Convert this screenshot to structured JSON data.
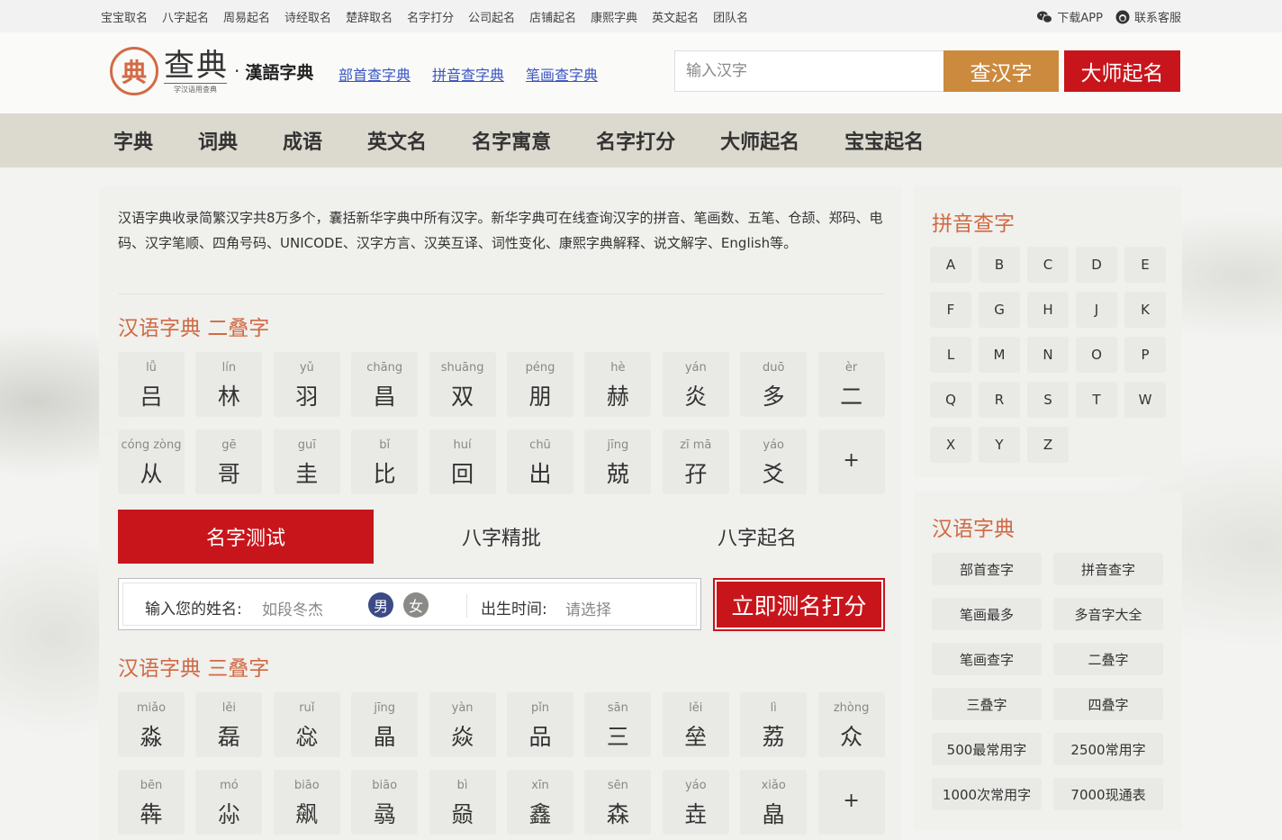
{
  "topbar": {
    "links": [
      "宝宝取名",
      "八字起名",
      "周易起名",
      "诗经取名",
      "楚辞取名",
      "名字打分",
      "公司起名",
      "店铺起名",
      "康熙字典",
      "英文起名",
      "团队名"
    ],
    "download": "下载APP",
    "service": "联系客服"
  },
  "header": {
    "logo_mark": "典",
    "logo_main": "查典",
    "logo_sub": "学汉语用查典",
    "logo_dot": "·",
    "logo_hanyu": "漢語字典",
    "links": [
      "部首查字典",
      "拼音查字典",
      "笔画查字典"
    ],
    "search_placeholder": "输入汉字",
    "search_button": "查汉字",
    "master_button": "大师起名"
  },
  "nav": [
    "字典",
    "词典",
    "成语",
    "英文名",
    "名字寓意",
    "名字打分",
    "大师起名",
    "宝宝起名"
  ],
  "main": {
    "intro": "汉语字典收录简繁汉字共8万多个，囊括新华字典中所有汉字。新华字典可在线查询汉字的拼音、笔画数、五笔、仓颉、郑码、电码、汉字笔顺、四角号码、UNICODE、汉字方言、汉英互译、词性变化、康熙字典解释、说文解字、English等。",
    "section_double": "汉语字典 二叠字",
    "double_chars": [
      {
        "py": "lǚ",
        "hz": "吕"
      },
      {
        "py": "lín",
        "hz": "林"
      },
      {
        "py": "yǔ",
        "hz": "羽"
      },
      {
        "py": "chāng",
        "hz": "昌"
      },
      {
        "py": "shuāng",
        "hz": "双"
      },
      {
        "py": "péng",
        "hz": "朋"
      },
      {
        "py": "hè",
        "hz": "赫"
      },
      {
        "py": "yán",
        "hz": "炎"
      },
      {
        "py": "duō",
        "hz": "多"
      },
      {
        "py": "èr",
        "hz": "二"
      },
      {
        "py": "cóng zòng",
        "hz": "从"
      },
      {
        "py": "gē",
        "hz": "哥"
      },
      {
        "py": "guī",
        "hz": "圭"
      },
      {
        "py": "bǐ",
        "hz": "比"
      },
      {
        "py": "huí",
        "hz": "回"
      },
      {
        "py": "chū",
        "hz": "出"
      },
      {
        "py": "jīng",
        "hz": "兢"
      },
      {
        "py": "zī mā",
        "hz": "孖"
      },
      {
        "py": "yáo",
        "hz": "爻"
      }
    ],
    "more": "+",
    "tabs": [
      "名字测试",
      "八字精批",
      "八字起名"
    ],
    "form": {
      "name_label": "输入您的姓名:",
      "name_placeholder": "如段冬杰",
      "male": "男",
      "female": "女",
      "birth_label": "出生时间:",
      "birth_placeholder": "请选择",
      "submit": "立即测名打分"
    },
    "section_triple": "汉语字典 三叠字",
    "triple_chars": [
      {
        "py": "miǎo",
        "hz": "淼"
      },
      {
        "py": "lěi",
        "hz": "磊"
      },
      {
        "py": "ruǐ",
        "hz": "惢"
      },
      {
        "py": "jīng",
        "hz": "晶"
      },
      {
        "py": "yàn",
        "hz": "焱"
      },
      {
        "py": "pǐn",
        "hz": "品"
      },
      {
        "py": "sān",
        "hz": "三"
      },
      {
        "py": "lěi",
        "hz": "垒"
      },
      {
        "py": "lì",
        "hz": "荔"
      },
      {
        "py": "zhòng",
        "hz": "众"
      },
      {
        "py": "bēn",
        "hz": "犇"
      },
      {
        "py": "mó",
        "hz": "尛"
      },
      {
        "py": "biāo",
        "hz": "飙"
      },
      {
        "py": "biāo",
        "hz": "骉"
      },
      {
        "py": "bì",
        "hz": "赑"
      },
      {
        "py": "xīn",
        "hz": "鑫"
      },
      {
        "py": "sēn",
        "hz": "森"
      },
      {
        "py": "yáo",
        "hz": "垚"
      },
      {
        "py": "xiǎo",
        "hz": "皛"
      }
    ]
  },
  "side": {
    "pinyin_title": "拼音查字",
    "letters": [
      "A",
      "B",
      "C",
      "D",
      "E",
      "F",
      "G",
      "H",
      "J",
      "K",
      "L",
      "M",
      "N",
      "O",
      "P",
      "Q",
      "R",
      "S",
      "T",
      "W",
      "X",
      "Y",
      "Z"
    ],
    "dict_title": "汉语字典",
    "dict_links": [
      "部首查字",
      "拼音查字",
      "笔画最多",
      "多音字大全",
      "笔画查字",
      "二叠字",
      "三叠字",
      "四叠字",
      "500最常用字",
      "2500常用字",
      "1000次常用字",
      "7000现通表"
    ]
  },
  "colors": {
    "accent_red": "#c8151b",
    "accent_orange": "#cb8a3e",
    "title_orange": "#d06a44",
    "link_blue": "#3a55c4",
    "male_blue": "#3c4a86",
    "female_gray": "#8a8a86"
  }
}
